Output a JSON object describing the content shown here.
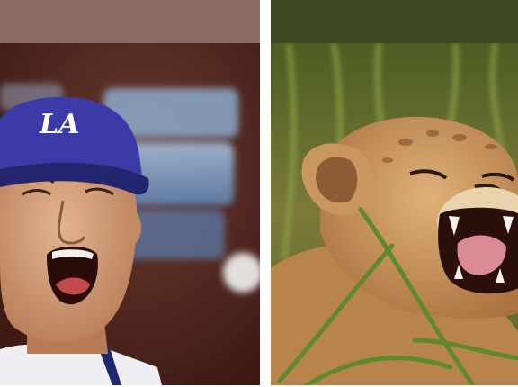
{
  "images": [
    {
      "subject": "baseball-player-yelling",
      "cap_logo": "LA",
      "colors": {
        "band": "#8b6a63",
        "cap": "#3b3aa6",
        "background": "#5b2a1f"
      }
    },
    {
      "subject": "lion-cub-roaring",
      "colors": {
        "band": "#3e4a25",
        "fur": "#c8925a",
        "grass": "#5f7a2f"
      }
    }
  ]
}
